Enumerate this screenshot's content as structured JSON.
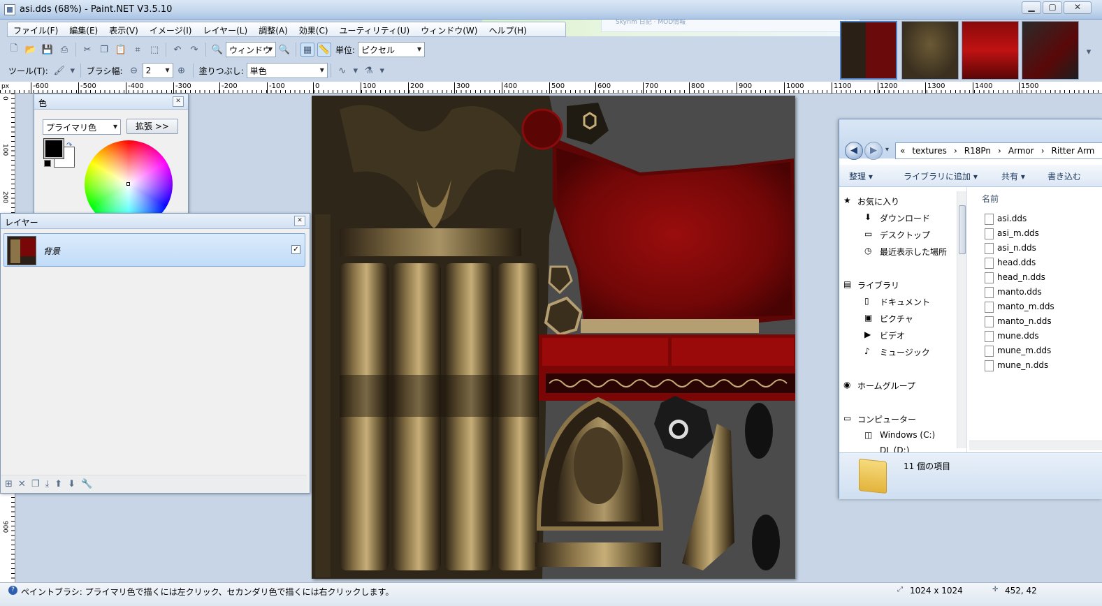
{
  "window": {
    "title": "asi.dds (68%) - Paint.NET V3.5.10"
  },
  "bg_window": {
    "text": "Skyrim 日記 · MOD情報"
  },
  "menu": [
    "ファイル(F)",
    "編集(E)",
    "表示(V)",
    "イメージ(I)",
    "レイヤー(L)",
    "調整(A)",
    "効果(C)",
    "ユーティリティ(U)",
    "ウィンドウ(W)",
    "ヘルプ(H)"
  ],
  "toolbar": {
    "zoom_value": "ウィンドウ",
    "units_label": "単位:",
    "units_value": "ピクセル",
    "tool_label": "ツール(T):",
    "brush_width_label": "ブラシ幅:",
    "brush_width_value": "2",
    "fill_label": "塗りつぶし:",
    "fill_value": "単色"
  },
  "ruler": {
    "unit": "px",
    "h_ticks": [
      "-600",
      "-500",
      "-400",
      "-300",
      "-200",
      "-100",
      "0",
      "100",
      "200",
      "300",
      "400",
      "500",
      "600",
      "700",
      "800",
      "900",
      "1000",
      "1100",
      "1200",
      "1300",
      "1400",
      "1500"
    ],
    "v_ticks": [
      "0",
      "100",
      "200",
      "900"
    ]
  },
  "colors_panel": {
    "title": "色",
    "mode": "プライマリ色",
    "expand_button": "拡張 >>",
    "primary_color": "#000000",
    "secondary_color": "#ffffff"
  },
  "layers_panel": {
    "title": "レイヤー",
    "layers": [
      {
        "name": "背景",
        "visible": "✓"
      }
    ]
  },
  "explorer": {
    "path": [
      "«",
      "textures",
      "›",
      "R18Pn",
      "›",
      "Armor",
      "›",
      "Ritter Arm"
    ],
    "commands": [
      "整理 ▾",
      "ライブラリに追加 ▾",
      "共有 ▾",
      "書き込む"
    ],
    "nav": {
      "favorites": "お気に入り",
      "downloads": "ダウンロード",
      "desktop": "デスクトップ",
      "recent": "最近表示した場所",
      "libraries": "ライブラリ",
      "documents": "ドキュメント",
      "pictures": "ピクチャ",
      "videos": "ビデオ",
      "music": "ミュージック",
      "homegroup": "ホームグループ",
      "computer": "コンピューター",
      "drive_c": "Windows (C:)",
      "drive_d": "DL (D:)"
    },
    "column_header": "名前",
    "files": [
      "asi.dds",
      "asi_m.dds",
      "asi_n.dds",
      "head.dds",
      "head_n.dds",
      "manto.dds",
      "manto_m.dds",
      "manto_n.dds",
      "mune.dds",
      "mune_m.dds",
      "mune_n.dds"
    ],
    "item_count": "11 個の項目"
  },
  "status": {
    "hint": "ペイントブラシ: プライマリ色で描くには左クリック、セカンダリ色で描くには右クリックします。",
    "image_size": "1024 x 1024",
    "cursor_pos": "452, 42"
  }
}
